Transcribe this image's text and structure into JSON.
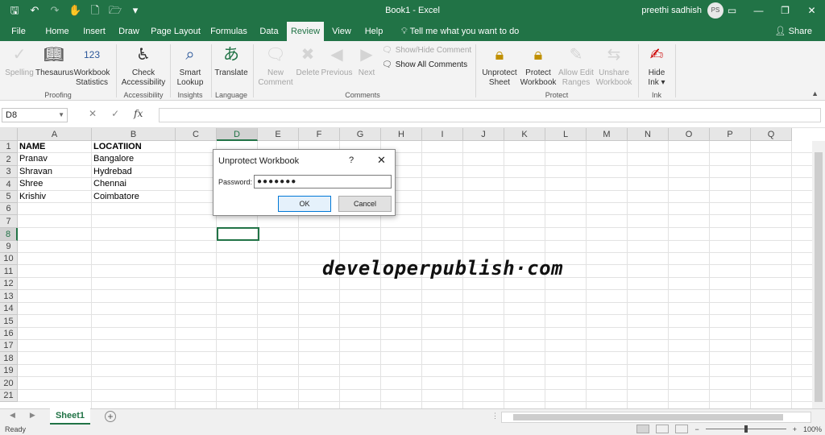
{
  "window": {
    "title": "Book1 - Excel",
    "user": "preethi sadhish",
    "avatar_initials": "PS",
    "accent": "#217346"
  },
  "quick_access": [
    {
      "icon": "save-icon",
      "glyph": "🖫"
    },
    {
      "icon": "undo-icon",
      "glyph": "↶"
    },
    {
      "icon": "redo-icon",
      "glyph": "↷"
    },
    {
      "icon": "touch-mode-icon",
      "glyph": "✋"
    },
    {
      "icon": "new-file-icon",
      "glyph": "🗋"
    },
    {
      "icon": "open-folder-icon",
      "glyph": "🗁"
    },
    {
      "icon": "customize-qat-icon",
      "glyph": "▾"
    }
  ],
  "tabs": [
    "File",
    "Home",
    "Insert",
    "Draw",
    "Page Layout",
    "Formulas",
    "Data",
    "Review",
    "View",
    "Help"
  ],
  "active_tab": "Review",
  "tellme": "Tell me what you want to do",
  "share": "Share",
  "ribbon": {
    "proofing": {
      "label": "Proofing",
      "spelling": "Spelling",
      "thesaurus": "Thesaurus",
      "workbook": "Workbook",
      "statistics": "Statistics"
    },
    "accessibility": {
      "label": "Accessibility",
      "check": "Check",
      "accessibility": "Accessibility"
    },
    "insights": {
      "label": "Insights",
      "smart": "Smart",
      "lookup": "Lookup"
    },
    "language": {
      "label": "Language",
      "translate": "Translate"
    },
    "comments": {
      "label": "Comments",
      "new": "New",
      "comment": "Comment",
      "delete": "Delete",
      "previous": "Previous",
      "next": "Next",
      "show_hide": "Show/Hide Comment",
      "show_all": "Show All Comments"
    },
    "protect": {
      "label": "Protect",
      "unprotect": "Unprotect",
      "sheet": "Sheet",
      "protect_w": "Protect",
      "workbook": "Workbook",
      "allow_edit": "Allow Edit",
      "ranges": "Ranges",
      "unshare": "Unshare",
      "unshare_workbook": "Workbook"
    },
    "ink": {
      "label": "Ink",
      "hide": "Hide",
      "ink_dd": "Ink ▾"
    }
  },
  "formula_bar": {
    "name_box": "D8",
    "formula": ""
  },
  "columns": [
    "A",
    "B",
    "C",
    "D",
    "E",
    "F",
    "G",
    "H",
    "I",
    "J",
    "K",
    "L",
    "M",
    "N",
    "O",
    "P",
    "Q"
  ],
  "rows": [
    "1",
    "2",
    "3",
    "4",
    "5",
    "6",
    "7",
    "8",
    "9",
    "10",
    "11",
    "12",
    "13",
    "14",
    "15",
    "16",
    "17",
    "18",
    "19",
    "20",
    "21"
  ],
  "cells": {
    "a1": "NAME",
    "b1": "LOCATIION",
    "a2": "Pranav",
    "b2": "Bangalore",
    "a3": "Shravan",
    "b3": "Hydrebad",
    "a4": "Shree",
    "b4": "Chennai",
    "a5": "Krishiv",
    "b5": "Coimbatore"
  },
  "watermark": "developerpublish·com",
  "sheet_tab": "Sheet1",
  "status": {
    "ready": "Ready",
    "zoom": "100%"
  },
  "dialog": {
    "title": "Unprotect Workbook",
    "help": "?",
    "close": "✕",
    "password_label": "Password:",
    "password_value": "●●●●●●●",
    "ok": "OK",
    "cancel": "Cancel"
  }
}
